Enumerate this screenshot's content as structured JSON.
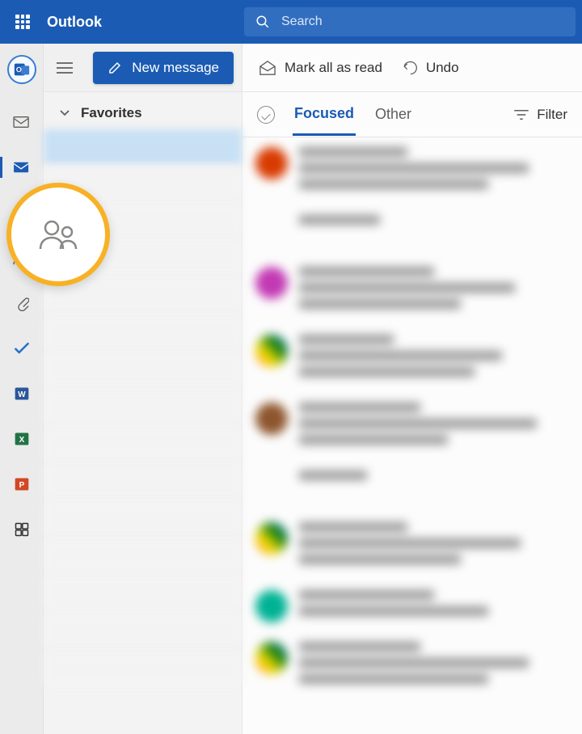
{
  "header": {
    "app_title": "Outlook",
    "search_placeholder": "Search"
  },
  "folder_pane": {
    "new_message_label": "New message",
    "favorites_label": "Favorites"
  },
  "action_bar": {
    "mark_read_label": "Mark all as read",
    "undo_label": "Undo"
  },
  "tabs": {
    "focused_label": "Focused",
    "other_label": "Other",
    "filter_label": "Filter"
  },
  "highlight": {
    "name": "people-navigation-highlight"
  },
  "colors": {
    "accent": "#1b5bb4",
    "highlight_ring": "#f8b125"
  }
}
